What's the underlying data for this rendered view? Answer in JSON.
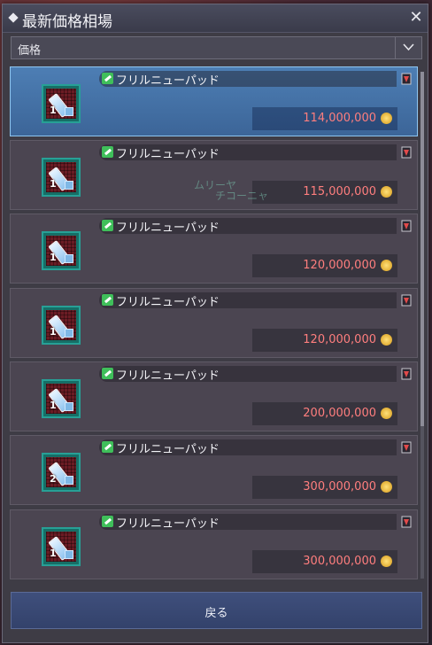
{
  "window": {
    "title": "最新価格相場"
  },
  "sort": {
    "selected": "価格"
  },
  "listings": [
    {
      "name": "フリルニューパッド",
      "count": "1",
      "price": "114,000,000",
      "selected": true
    },
    {
      "name": "フリルニューパッド",
      "count": "1",
      "price": "115,000,000",
      "selected": false
    },
    {
      "name": "フリルニューパッド",
      "count": "1",
      "price": "120,000,000",
      "selected": false
    },
    {
      "name": "フリルニューパッド",
      "count": "1",
      "price": "120,000,000",
      "selected": false
    },
    {
      "name": "フリルニューパッド",
      "count": "1",
      "price": "200,000,000",
      "selected": false
    },
    {
      "name": "フリルニューパッド",
      "count": "2",
      "price": "300,000,000",
      "selected": false
    },
    {
      "name": "フリルニューパッド",
      "count": "1",
      "price": "300,000,000",
      "selected": false
    }
  ],
  "overlay_players": [
    "ムリーヤ",
    "チコーニャ"
  ],
  "footer": {
    "back_label": "戻る"
  },
  "colors": {
    "price": "#ff7e7e",
    "selected_row": "#4d7eb4",
    "slot_border": "#27a096",
    "tag": "#3fbf5a"
  },
  "icons": {
    "close": "close-icon",
    "dropdown": "chevron-down-icon",
    "currency": "coin-icon",
    "item_type": "pad-icon"
  }
}
